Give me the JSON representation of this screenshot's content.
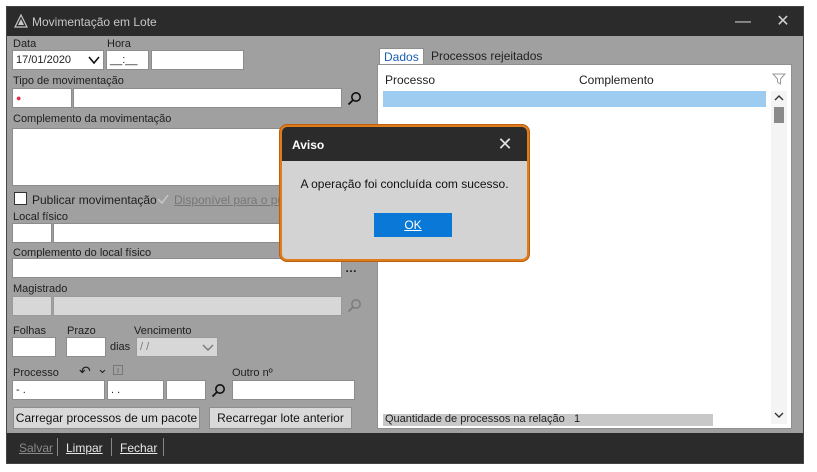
{
  "window": {
    "title": "Movimentação em Lote",
    "minimize_glyph": "—",
    "close_glyph": "✕"
  },
  "form": {
    "data_label": "Data",
    "data_value": "17/01/2020",
    "hora_label": "Hora",
    "hora_value": "__:__",
    "tipo_label": "Tipo de movimentação",
    "tipo_required_dot": "●",
    "complemento_label": "Complemento da movimentação",
    "publicar_label": "Publicar movimentação",
    "disponivel_label": "Disponível para o púb",
    "local_label": "Local físico",
    "complemento_local_label": "Complemento do local físico",
    "ellipsis": "…",
    "magistrado_label": "Magistrado",
    "folhas_label": "Folhas",
    "prazo_label": "Prazo",
    "dias_label": "dias",
    "vencimento_label": "Vencimento",
    "vencimento_value": " /  /",
    "processo_label": "Processo",
    "processo_part1": "  - .",
    "processo_part2": " . .",
    "outro_label": "Outro nº",
    "undo_glyph": "↶",
    "chevron_glyph": "⌄",
    "carregar_button": "Carregar processos de um pacote",
    "recarregar_button": "Recarregar lote anterior"
  },
  "tabs": [
    {
      "label": "Dados"
    },
    {
      "label": "Processos rejeitados"
    }
  ],
  "grid": {
    "col_processo": "Processo",
    "col_complemento": "Complemento",
    "quantidade_label": "Quantidade de processos na relação",
    "quantidade_value": "1"
  },
  "bottom": {
    "salvar": "Salvar",
    "limpar": "Limpar",
    "fechar": "Fechar"
  },
  "dialog": {
    "title": "Aviso",
    "close_glyph": "✕",
    "message": "A operação foi concluída com sucesso.",
    "ok_label": "OK"
  },
  "colors": {
    "accent_border": "#e07c1a",
    "ok_button": "#0a78d7",
    "selection": "#9ecbf0",
    "titlebar": "#2b2b2b"
  }
}
